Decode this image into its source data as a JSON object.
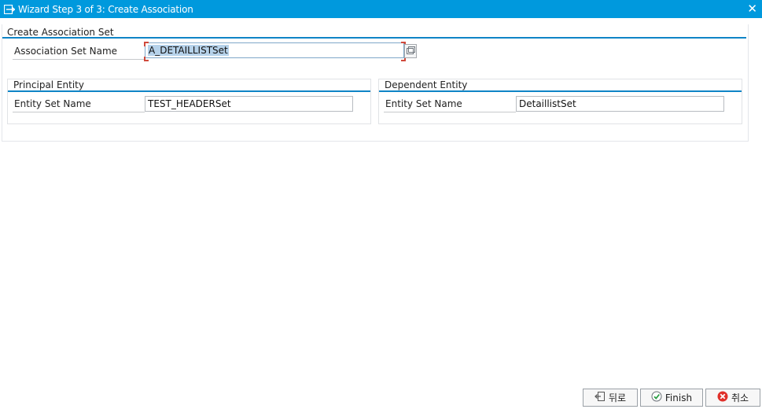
{
  "window": {
    "title": "Wizard Step 3 of 3: Create Association",
    "title_icon": "wizard-icon",
    "close_icon": "close-icon",
    "close_glyph": "✕"
  },
  "association_set": {
    "group_title": "Create Association Set",
    "name_label": "Association Set Name",
    "name_value": "A_DETAILLISTSet",
    "value_help_icon": "value-help-icon"
  },
  "principal": {
    "group_title": "Principal Entity",
    "set_label": "Entity Set Name",
    "set_value": "TEST_HEADERSet"
  },
  "dependent": {
    "group_title": "Dependent Entity",
    "set_label": "Entity Set Name",
    "set_value": "DetaillistSet"
  },
  "footer": {
    "back_label": "뒤로",
    "back_icon": "back-icon",
    "finish_label": "Finish",
    "finish_icon": "finish-icon",
    "cancel_label": "취소",
    "cancel_icon": "cancel-icon"
  },
  "colors": {
    "titlebar": "#0099dd",
    "group_line": "#0f84c6",
    "selection": "#b6d2ea",
    "cancel_red": "#e0302a",
    "finish_green": "#2c9f45"
  }
}
